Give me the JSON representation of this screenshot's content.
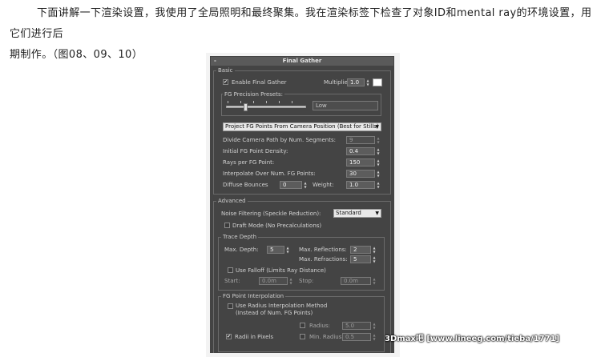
{
  "article": {
    "line1": "下面讲解一下渲染设置，我使用了全局照明和最终聚集。我在渲染标签下检查了对象ID和mental ray的环境设置，用它们进行后",
    "line2": "期制作。（图08、09、10）"
  },
  "panel": {
    "title": "Final Gather",
    "collapse_symbol": "-",
    "basic": {
      "group_label": "Basic",
      "enable_fg": {
        "label": "Enable Final Gather",
        "checked": true
      },
      "multiplier": {
        "label": "Multiplier:",
        "value": "1.0"
      },
      "presets": {
        "label": "FG Precision Presets:",
        "value": "Low"
      },
      "projection": {
        "value": "Project FG Points From Camera Position (Best for Stills)"
      },
      "divide_path": {
        "label": "Divide Camera Path by Num. Segments:",
        "value": "9"
      },
      "density": {
        "label": "Initial FG Point Density:",
        "value": "0.4"
      },
      "rays": {
        "label": "Rays per FG Point:",
        "value": "150"
      },
      "interpolate": {
        "label": "Interpolate Over Num. FG Points:",
        "value": "30"
      },
      "diffuse": {
        "label": "Diffuse Bounces",
        "value": "0"
      },
      "weight": {
        "label": "Weight:",
        "value": "1.0"
      }
    },
    "advanced": {
      "group_label": "Advanced",
      "noise": {
        "label": "Noise Filtering (Speckle Reduction):",
        "value": "Standard"
      },
      "draft": {
        "label": "Draft Mode (No Precalculations)",
        "checked": false
      }
    },
    "trace_depth": {
      "group_label": "Trace Depth",
      "max_depth": {
        "label": "Max. Depth:",
        "value": "5"
      },
      "max_reflections": {
        "label": "Max. Reflections:",
        "value": "2"
      },
      "max_refractions": {
        "label": "Max. Refractions:",
        "value": "5"
      },
      "use_falloff": {
        "label": "Use Falloff (Limits Ray Distance)",
        "checked": false
      },
      "start": {
        "label": "Start:",
        "value": "0.0m"
      },
      "stop": {
        "label": "Stop:",
        "value": "0.0m"
      }
    },
    "fg_interp": {
      "group_label": "FG Point Interpolation",
      "use_radius": {
        "label_line1": "Use Radius Interpolation Method",
        "label_line2": "(Instead of Num. FG Points)",
        "checked": false
      },
      "radius": {
        "label": "Radius:",
        "value": "5.0",
        "checked": false
      },
      "radii_pixels": {
        "label": "Radii in Pixels",
        "checked": true
      },
      "min_radius": {
        "label": "Min. Radius:",
        "value": "0.5",
        "checked": false
      }
    }
  },
  "watermark": {
    "text": "3Dmax吧 [www.lineeg.com/tieba/1771]"
  }
}
